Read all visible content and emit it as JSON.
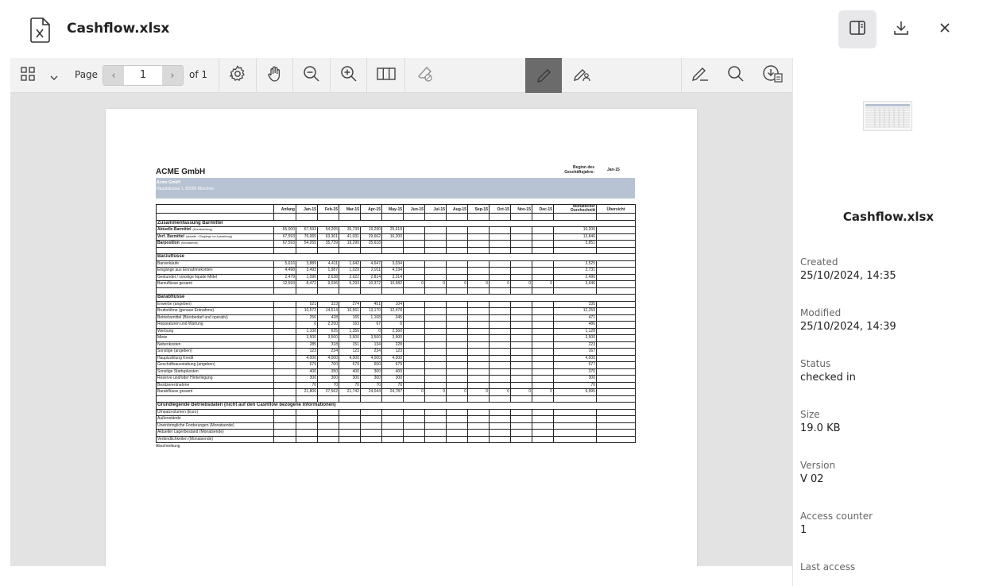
{
  "header": {
    "file_title": "Cashflow.xlsx"
  },
  "toolbar": {
    "page_label": "Page",
    "page_current": "1",
    "page_total": "of 1"
  },
  "sheet": {
    "company": "ACME GmbH",
    "begin_label": "Beginn des Geschäftsjahrs:",
    "begin_value": "Jan-15",
    "address_line1": "Acme GmbH",
    "address_line2": "Hauptstrasse 1, 80000 München",
    "headers": [
      "",
      "Anfang",
      "Jan-15",
      "Feb-15",
      "Mar-15",
      "Apr-15",
      "May-15",
      "Jun-15",
      "Jul-15",
      "Aug-15",
      "Sep-15",
      "Oct-15",
      "Nov-15",
      "Dec-15",
      "Monatlicher Durchschnitt",
      "Übersicht"
    ],
    "rows": [
      {
        "type": "blank"
      },
      {
        "type": "section",
        "label": "Zusammenfassung Barmittel"
      },
      {
        "label": "Aktuelle Barmittel",
        "note": "(Monatsanfang)",
        "bold": true,
        "cells": [
          "55,000",
          "67,593",
          "54,265",
          "35,739",
          "19,290",
          "25,618",
          "",
          "",
          "",
          "",
          "",
          "",
          "",
          "10,200",
          ""
        ]
      },
      {
        "label": "Verf. Barmittel",
        "note": "(aktuelle + Eingänge vor Auszahlung)",
        "bold": true,
        "cells": [
          "67,593",
          "76,065",
          "63,301",
          "41,031",
          "29,662",
          "16,200",
          "",
          "",
          "",
          "",
          "",
          "",
          "",
          "13,846",
          ""
        ]
      },
      {
        "label": "Barposition",
        "note": "(Monatsende)",
        "bold": true,
        "cells": [
          "67,593",
          "54,265",
          "35,739",
          "19,290",
          "25,618",
          "",
          "",
          "",
          "",
          "",
          "",
          "",
          "",
          "3,851",
          ""
        ]
      },
      {
        "type": "blank"
      },
      {
        "type": "section",
        "label": "Barzuflüsse"
      },
      {
        "label": "Barverkäufe",
        "cells": [
          "5,616",
          "3,889",
          "4,411",
          "1,642",
          "4,647",
          "3,034",
          "",
          "",
          "",
          "",
          "",
          "",
          "",
          "3,525",
          ""
        ]
      },
      {
        "label": "Eingänge aus Einnahmekonten",
        "cells": [
          "4,498",
          "3,493",
          "1,987",
          "1,029",
          "2,911",
          "4,234",
          "",
          "",
          "",
          "",
          "",
          "",
          "",
          "2,731",
          ""
        ]
      },
      {
        "label": "Gestundet / sonstige liquide Mittel",
        "cells": [
          "2,479",
          "1,090",
          "2,638",
          "2,622",
          "2,814",
          "3,314",
          "",
          "",
          "",
          "",
          "",
          "",
          "",
          "2,496",
          ""
        ]
      },
      {
        "label": "Barzuflüsse gesamt",
        "cells": [
          "12,593",
          "8,472",
          "9,036",
          "5,293",
          "10,372",
          "10,582",
          "0",
          "0",
          "0",
          "0",
          "0",
          "0",
          "0",
          "3,646",
          ""
        ]
      },
      {
        "type": "blank"
      },
      {
        "type": "section",
        "label": "Barabflüsse"
      },
      {
        "label": "Erwerbe (angeben)",
        "cells": [
          "",
          "521",
          "323",
          "274",
          "451",
          "104",
          "",
          "",
          "",
          "",
          "",
          "",
          "",
          "335",
          ""
        ]
      },
      {
        "label": "Bruttolöhne (genaue Entnahme)",
        "cells": [
          "",
          "10,572",
          "14,514",
          "10,561",
          "13,170",
          "12,478",
          "",
          "",
          "",
          "",
          "",
          "",
          "",
          "12,259",
          ""
        ]
      },
      {
        "label": "Betriebsmittel (Bürobedarf und operativ)",
        "cells": [
          "",
          "250",
          "428",
          "165",
          "1,168",
          "345",
          "",
          "",
          "",
          "",
          "",
          "",
          "",
          "471",
          ""
        ]
      },
      {
        "label": "Reparaturen und Wartung",
        "cells": [
          "",
          "0",
          "2,200",
          "163",
          "67",
          "0",
          "",
          "",
          "",
          "",
          "",
          "",
          "",
          "486",
          ""
        ]
      },
      {
        "label": "Werbung",
        "cells": [
          "",
          "1,100",
          "625",
          "1,356",
          "0",
          "2,560",
          "",
          "",
          "",
          "",
          "",
          "",
          "",
          "1,128",
          ""
        ]
      },
      {
        "label": "Miete",
        "cells": [
          "",
          "3,500",
          "3,500",
          "3,500",
          "3,500",
          "3,500",
          "",
          "",
          "",
          "",
          "",
          "",
          "",
          "3,500",
          ""
        ]
      },
      {
        "label": "Nebenkosten",
        "cells": [
          "",
          "285",
          "318",
          "151",
          "134",
          "228",
          "",
          "",
          "",
          "",
          "",
          "",
          "",
          "223",
          ""
        ]
      },
      {
        "label": "Sonstige (angeben)",
        "cells": [
          "",
          "123",
          "234",
          "123",
          "234",
          "123",
          "",
          "",
          "",
          "",
          "",
          "",
          "",
          "167",
          ""
        ]
      },
      {
        "label": "Hauptzahlung Kredit",
        "cells": [
          "",
          "4,000",
          "4,000",
          "4,000",
          "4,000",
          "4,000",
          "",
          "",
          "",
          "",
          "",
          "",
          "",
          "4,000",
          ""
        ]
      },
      {
        "label": "Geschäftsausstattung (angeben)",
        "cells": [
          "",
          "679",
          "700",
          "679",
          "650",
          "679",
          "",
          "",
          "",
          "",
          "",
          "",
          "",
          "677",
          ""
        ]
      },
      {
        "label": "Sonstige Startupkosten",
        "cells": [
          "",
          "400",
          "350",
          "400",
          "300",
          "400",
          "",
          "",
          "",
          "",
          "",
          "",
          "",
          "370",
          ""
        ]
      },
      {
        "label": "Reserve und/oder Hinterlegung",
        "cells": [
          "",
          "300",
          "300",
          "300",
          "300",
          "300",
          "",
          "",
          "",
          "",
          "",
          "",
          "",
          "300",
          ""
        ]
      },
      {
        "label": "Besitzerentnahme",
        "cells": [
          "",
          "70",
          "70",
          "70",
          "70",
          "70",
          "",
          "",
          "",
          "",
          "",
          "",
          "",
          "70",
          ""
        ]
      },
      {
        "label": "Barabflüsse gesamt",
        "cells": [
          "",
          "21,800",
          "27,562",
          "21,742",
          "24,044",
          "24,787",
          "0",
          "0",
          "0",
          "0",
          "0",
          "0",
          "0",
          "9,995",
          ""
        ]
      },
      {
        "type": "blank"
      },
      {
        "type": "section",
        "label": "Grundlegende Betriebsdaten (nicht auf den Cashflow bezogene Informationen)"
      },
      {
        "label": "Umsatzvolumen (Euro)",
        "cells": [
          "",
          "",
          "",
          "",
          "",
          "",
          "",
          "",
          "",
          "",
          "",
          "",
          "",
          "",
          ""
        ]
      },
      {
        "label": "Außenstände",
        "cells": [
          "",
          "",
          "",
          "",
          "",
          "",
          "",
          "",
          "",
          "",
          "",
          "",
          "",
          "",
          ""
        ]
      },
      {
        "label": "Uneinbringliche Forderungen (Monatsende)",
        "cells": [
          "",
          "",
          "",
          "",
          "",
          "",
          "",
          "",
          "",
          "",
          "",
          "",
          "",
          "",
          ""
        ]
      },
      {
        "label": "Aktueller Lagerbestand (Monatsende)",
        "cells": [
          "",
          "",
          "",
          "",
          "",
          "",
          "",
          "",
          "",
          "",
          "",
          "",
          "",
          "",
          ""
        ]
      },
      {
        "label": "Verbindlichkeiten (Monatsende)",
        "cells": [
          "",
          "",
          "",
          "",
          "",
          "",
          "",
          "",
          "",
          "",
          "",
          "",
          "",
          "",
          ""
        ]
      }
    ],
    "footer_label": "Abschreibung"
  },
  "sidebar": {
    "title": "Cashflow.xlsx",
    "fields": [
      {
        "key": "Created",
        "value": "25/10/2024, 14:35"
      },
      {
        "key": "Modified",
        "value": "25/10/2024, 14:39"
      },
      {
        "key": "Status",
        "value": "checked in"
      },
      {
        "key": "Size",
        "value": "19.0 KB"
      },
      {
        "key": "Version",
        "value": "V 02"
      },
      {
        "key": "Access counter",
        "value": "1"
      },
      {
        "key": "Last access",
        "value": ""
      }
    ]
  }
}
